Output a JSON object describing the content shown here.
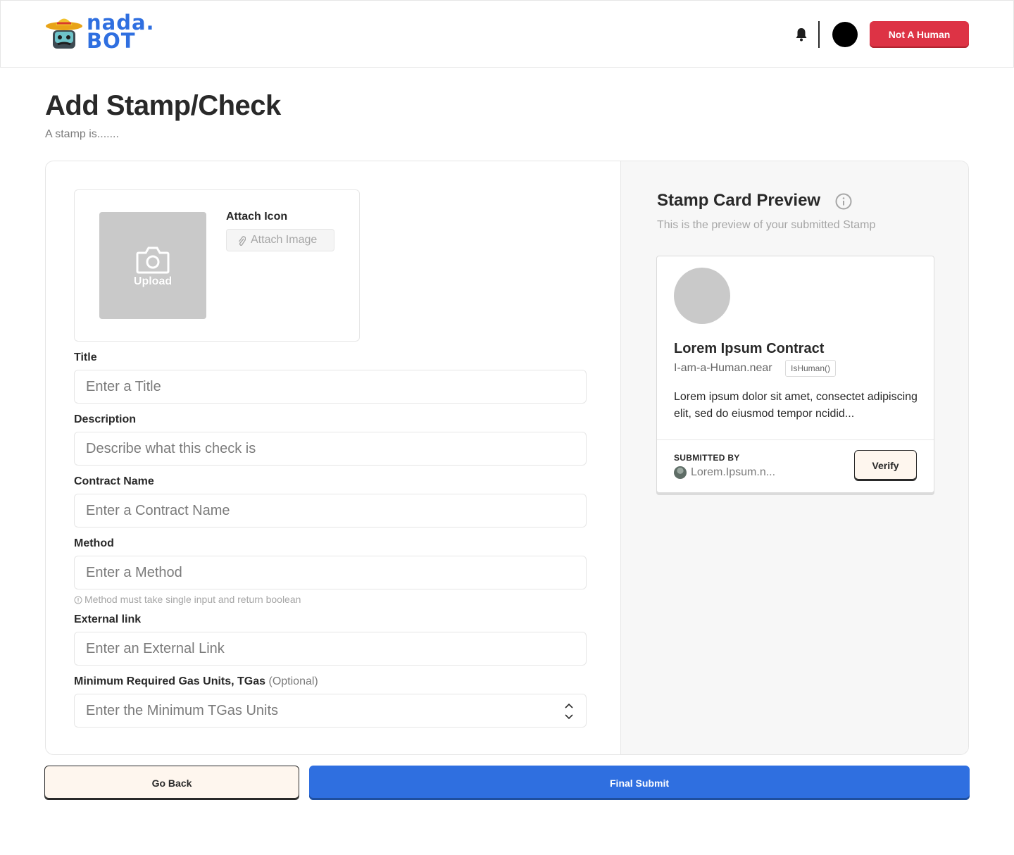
{
  "header": {
    "logo_line1": "nada.",
    "logo_line2": "BOT",
    "not_human_label": "Not A Human"
  },
  "page": {
    "title": "Add Stamp/Check",
    "subtitle": "A stamp is......."
  },
  "form": {
    "upload_label": "Upload",
    "attach_title": "Attach Icon",
    "attach_button": "Attach Image",
    "title_label": "Title",
    "title_placeholder": "Enter a Title",
    "description_label": "Description",
    "description_placeholder": "Describe what this check is",
    "contract_label": "Contract Name",
    "contract_placeholder": "Enter a Contract Name",
    "method_label": "Method",
    "method_placeholder": "Enter a Method",
    "method_hint": "Method must take single input and return boolean",
    "link_label": "External link",
    "link_placeholder": "Enter an External Link",
    "gas_label": "Minimum Required Gas Units, TGas",
    "gas_optional": "(Optional)",
    "gas_placeholder": "Enter the Minimum TGas Units"
  },
  "preview": {
    "title": "Stamp Card Preview",
    "subtitle": "This is the preview of your submitted Stamp",
    "card": {
      "title": "Lorem Ipsum Contract",
      "account": "I-am-a-Human.near",
      "method": "IsHuman()",
      "description": "Lorem ipsum dolor sit amet, consectet adipiscing elit, sed do eiusmod tempor ncidid...",
      "submitted_by_label": "SUBMITTED BY",
      "submitter": "Lorem.Ipsum.n...",
      "verify_label": "Verify"
    }
  },
  "actions": {
    "back_label": "Go Back",
    "submit_label": "Final Submit"
  },
  "colors": {
    "accent_blue": "#2f6fe0",
    "danger_red": "#dd3345",
    "cream": "#fef6ee"
  }
}
